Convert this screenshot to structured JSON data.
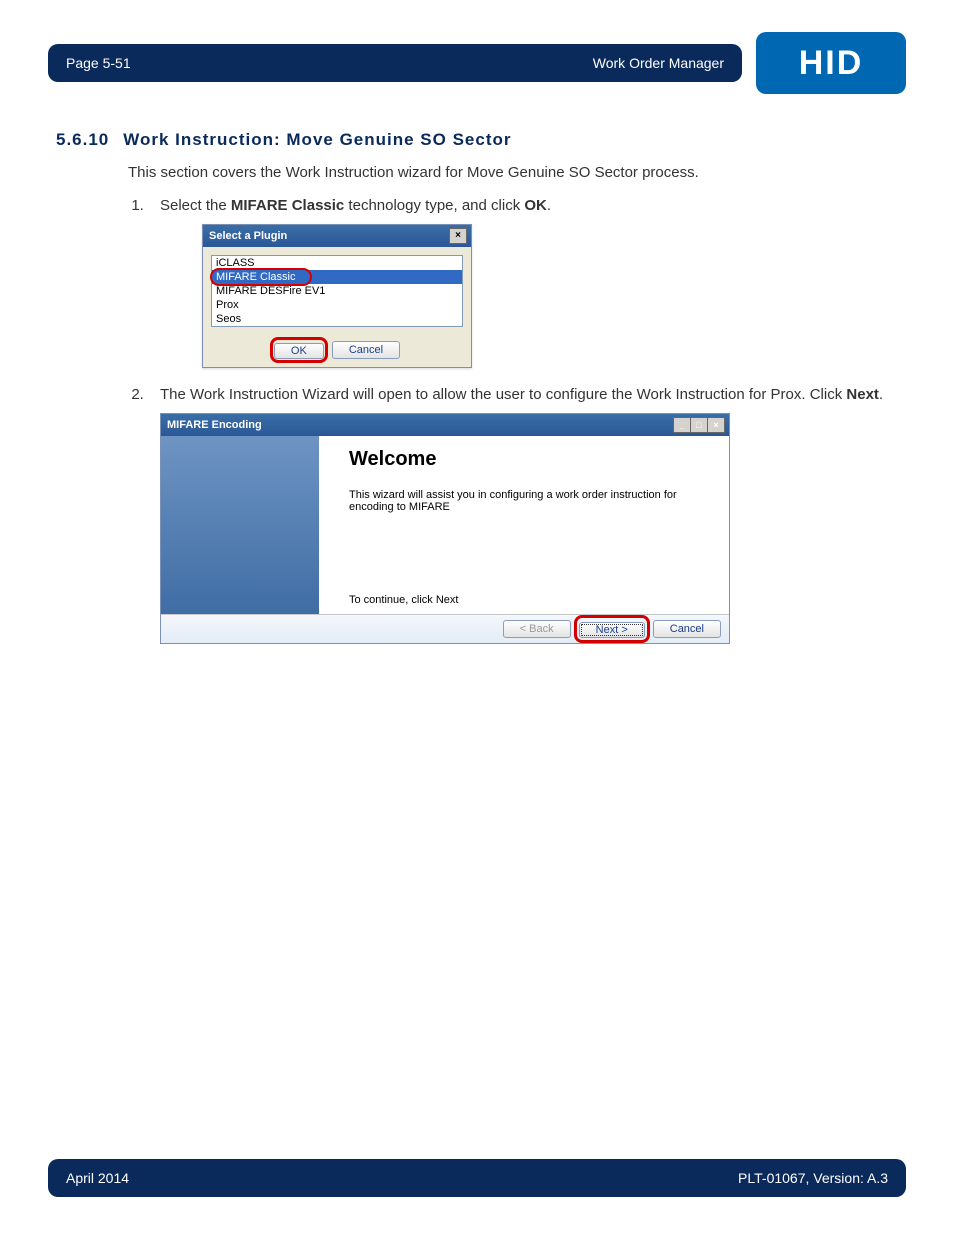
{
  "header": {
    "page_label": "Page 5-51",
    "doc_section": "Work Order Manager",
    "logo_text": "HID"
  },
  "section": {
    "number": "5.6.10",
    "title": "Work Instruction: Move Genuine SO Sector",
    "intro": "This section covers the Work Instruction wizard for Move Genuine SO Sector process."
  },
  "steps": {
    "s1_pre": "Select the ",
    "s1_bold1": "MIFARE Classic",
    "s1_mid": " technology type, and click ",
    "s1_bold2": "OK",
    "s1_post": ".",
    "s2_pre": "The Work Instruction Wizard will open to allow the user to configure the Work Instruction for Prox. Click ",
    "s2_bold": "Next",
    "s2_post": "."
  },
  "dialog1": {
    "title": "Select a Plugin",
    "close": "×",
    "items": [
      "iCLASS",
      "MIFARE Classic",
      "MIFARE DESFire EV1",
      "Prox",
      "Seos"
    ],
    "selected_index": 1,
    "ok": "OK",
    "cancel": "Cancel"
  },
  "dialog2": {
    "title": "MIFARE Encoding",
    "min": "_",
    "max": "□",
    "close": "×",
    "heading": "Welcome",
    "desc": "This wizard will assist you in configuring a work order instruction for encoding to MIFARE",
    "continue": "To continue, click Next",
    "back": "< Back",
    "next": "Next >",
    "cancel": "Cancel"
  },
  "footer": {
    "left": "April 2014",
    "right": "PLT-01067, Version: A.3"
  }
}
